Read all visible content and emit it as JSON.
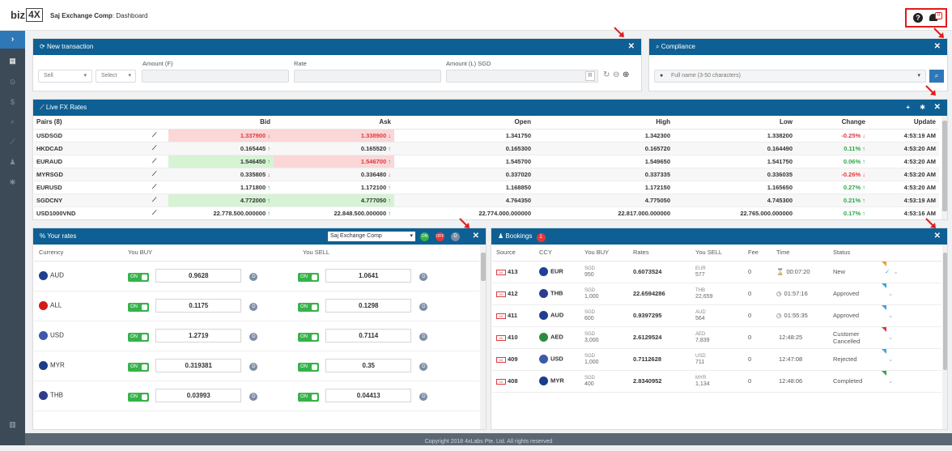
{
  "app": {
    "logo_a": "biz",
    "logo_b": "4X",
    "company": "Saj Exchange Comp",
    "page": ": Dashboard"
  },
  "header": {
    "help_icon": "question-circle-icon",
    "bell_icon": "bell-icon",
    "notif_count": "0"
  },
  "sidebar": {
    "toggle": "›",
    "items": [
      "dashboard-icon",
      "money-icon",
      "dollar-icon",
      "search-icon",
      "chart-icon",
      "users-icon",
      "gear-icon"
    ],
    "bottom": "building-icon"
  },
  "new_transaction": {
    "title": "New transaction",
    "close": "✕",
    "amount_f_label": "Amount (F)",
    "rate_label": "Rate",
    "amount_l_label": "Amount (L) SGD",
    "side_value": "Sell",
    "ccy_value": "Select",
    "r_label": "R"
  },
  "compliance": {
    "title": "Compliance",
    "close": "✕",
    "placeholder": "Full name (3-50 characters)"
  },
  "live_fx": {
    "title": "Live FX Rates",
    "columns": [
      "Pairs (8)",
      "",
      "Bid",
      "Ask",
      "Open",
      "High",
      "Low",
      "Change",
      "Update"
    ],
    "rows": [
      {
        "pair": "USDSGD",
        "bid": "1.337900",
        "bid_dir": "dn",
        "ask": "1.338900",
        "ask_dir": "dn",
        "open": "1.341750",
        "high": "1.342300",
        "low": "1.338200",
        "change": "-0.25%",
        "change_dir": "dn",
        "update": "4:53:19 AM",
        "bid_bg": "red",
        "ask_bg": "red"
      },
      {
        "pair": "HKDCAD",
        "bid": "0.165445",
        "bid_dir": "up",
        "ask": "0.165520",
        "ask_dir": "up",
        "open": "0.165300",
        "high": "0.165720",
        "low": "0.164490",
        "change": "0.11%",
        "change_dir": "up",
        "update": "4:53:20 AM",
        "bid_bg": "",
        "ask_bg": ""
      },
      {
        "pair": "EURAUD",
        "bid": "1.546450",
        "bid_dir": "up",
        "ask": "1.546700",
        "ask_dir": "up",
        "open": "1.545700",
        "high": "1.549650",
        "low": "1.541750",
        "change": "0.06%",
        "change_dir": "up",
        "update": "4:53:20 AM",
        "bid_bg": "green",
        "ask_bg": "red"
      },
      {
        "pair": "MYRSGD",
        "bid": "0.335805",
        "bid_dir": "dn",
        "ask": "0.336480",
        "ask_dir": "dn",
        "open": "0.337020",
        "high": "0.337335",
        "low": "0.336035",
        "change": "-0.26%",
        "change_dir": "dn",
        "update": "4:53:20 AM",
        "bid_bg": "",
        "ask_bg": ""
      },
      {
        "pair": "EURUSD",
        "bid": "1.171800",
        "bid_dir": "up",
        "ask": "1.172100",
        "ask_dir": "up",
        "open": "1.168850",
        "high": "1.172150",
        "low": "1.165650",
        "change": "0.27%",
        "change_dir": "up",
        "update": "4:53:20 AM",
        "bid_bg": "",
        "ask_bg": ""
      },
      {
        "pair": "SGDCNY",
        "bid": "4.772000",
        "bid_dir": "up",
        "ask": "4.777050",
        "ask_dir": "up",
        "open": "4.764350",
        "high": "4.775050",
        "low": "4.745300",
        "change": "0.21%",
        "change_dir": "up",
        "update": "4:53:19 AM",
        "bid_bg": "green",
        "ask_bg": "green"
      },
      {
        "pair": "USD1000VND",
        "bid": "22.778.500.000000",
        "bid_dir": "up",
        "ask": "22.848.500.000000",
        "ask_dir": "up",
        "open": "22.774.000.000000",
        "high": "22.817.000.000000",
        "low": "22.765.000.000000",
        "change": "0.17%",
        "change_dir": "up",
        "update": "4:53:16 AM",
        "bid_bg": "",
        "ask_bg": ""
      }
    ]
  },
  "your_rates": {
    "title": "Your rates",
    "company_select": "Saj Exchange Comp",
    "on_label": "ON",
    "off_label": "OFF",
    "d_label": "D",
    "columns": [
      "Currency",
      "You BUY",
      "You SELL"
    ],
    "rows": [
      {
        "ccy": "AUD",
        "buy": "0.9628",
        "sell": "1.0641"
      },
      {
        "ccy": "ALL",
        "buy": "0.1175",
        "sell": "0.1298"
      },
      {
        "ccy": "USD",
        "buy": "1.2719",
        "sell": "0.7114"
      },
      {
        "ccy": "MYR",
        "buy": "0.319381",
        "sell": "0.35"
      },
      {
        "ccy": "THB",
        "buy": "0.03993",
        "sell": "0.04413"
      }
    ]
  },
  "bookings": {
    "title": "Bookings",
    "count": "1",
    "columns": [
      "Source",
      "CCY",
      "You BUY",
      "Rates",
      "You SELL",
      "Fee",
      "Time",
      "Status"
    ],
    "rows": [
      {
        "id": "413",
        "ccy": "EUR",
        "buy_c": "SGD",
        "buy_v": "950",
        "rate": "0.6073524",
        "sell_c": "EUR",
        "sell_v": "577",
        "fee": "0",
        "time": "00:07:20",
        "time_icon": "hourglass-icon",
        "status": "New",
        "tri": "#f0a02a"
      },
      {
        "id": "412",
        "ccy": "THB",
        "buy_c": "SGD",
        "buy_v": "1,000",
        "rate": "22.6594286",
        "sell_c": "THB",
        "sell_v": "22,659",
        "fee": "0",
        "time": "01:57:16",
        "time_icon": "clock-icon",
        "status": "Approved",
        "tri": "#3aa7dc"
      },
      {
        "id": "411",
        "ccy": "AUD",
        "buy_c": "SGD",
        "buy_v": "600",
        "rate": "0.9397295",
        "sell_c": "AUD",
        "sell_v": "564",
        "fee": "0",
        "time": "01:55:35",
        "time_icon": "clock-icon",
        "status": "Approved",
        "tri": "#3aa7dc"
      },
      {
        "id": "410",
        "ccy": "AED",
        "buy_c": "SGD",
        "buy_v": "3,000",
        "rate": "2.6129524",
        "sell_c": "AED",
        "sell_v": "7,839",
        "fee": "0",
        "time": "12:48:25",
        "time_icon": "",
        "status": "Customer Cancelled",
        "tri": "#e0383e"
      },
      {
        "id": "409",
        "ccy": "USD",
        "buy_c": "SGD",
        "buy_v": "1,000",
        "rate": "0.7112628",
        "sell_c": "USD",
        "sell_v": "711",
        "fee": "0",
        "time": "12:47:08",
        "time_icon": "",
        "status": "Rejected",
        "tri": "#3aa7dc"
      },
      {
        "id": "408",
        "ccy": "MYR",
        "buy_c": "SGD",
        "buy_v": "400",
        "rate": "2.8340952",
        "sell_c": "MYR",
        "sell_v": "1,134",
        "fee": "0",
        "time": "12:48:06",
        "time_icon": "",
        "status": "Completed",
        "tri": "#29a847"
      }
    ]
  },
  "footer": {
    "text": "Copyright 2018 4xLabs Pte. Ltd. All rights reserved"
  },
  "colors": {
    "header_blue": "#0e5f93",
    "sidebar": "#3c4a58",
    "up": "#29a847",
    "down": "#e0383e",
    "highlight": "#e21b1b"
  }
}
